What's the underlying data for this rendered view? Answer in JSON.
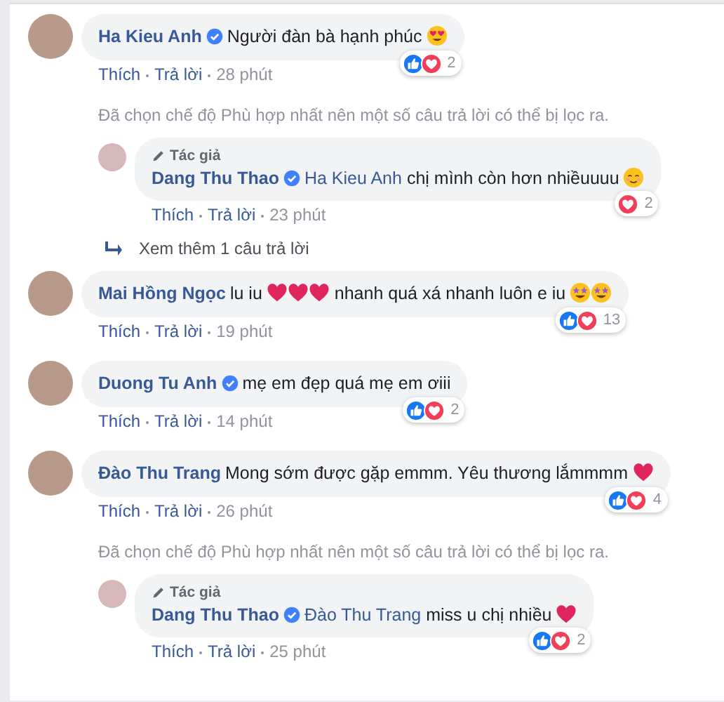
{
  "comments": [
    {
      "author": "Ha Kieu Anh",
      "verified": true,
      "body": [
        {
          "kind": "text",
          "text": "Người đàn bà hạnh phúc"
        },
        {
          "kind": "love-face"
        }
      ],
      "reactions": {
        "types": [
          {
            "kind": "like"
          },
          {
            "kind": "love"
          }
        ],
        "count": "2"
      },
      "actions": {
        "like": "Thích",
        "reply": "Trả lời",
        "time": "28 phút"
      },
      "children": [
        {
          "kind": "notice",
          "text": "Đã chọn chế độ Phù hợp nhất nên một số câu trả lời có thể bị lọc ra."
        },
        {
          "kind": "reply",
          "author_badge": "Tác giả",
          "author": "Dang Thu Thao",
          "verified": true,
          "body": [
            {
              "kind": "mention",
              "text": "Ha Kieu Anh"
            },
            {
              "kind": "text",
              "text": "chị mình còn hơn nhiềuuuu"
            },
            {
              "kind": "smile-face"
            }
          ],
          "reactions": {
            "types": [
              {
                "kind": "love"
              }
            ],
            "count": "2"
          },
          "actions": {
            "like": "Thích",
            "reply": "Trả lời",
            "time": "23 phút"
          }
        },
        {
          "kind": "more",
          "text": "Xem thêm 1 câu trả lời"
        }
      ]
    },
    {
      "author": "Mai Hồng Ngọc",
      "verified": false,
      "body": [
        {
          "kind": "text",
          "text": "lu iu"
        },
        {
          "kind": "heart"
        },
        {
          "kind": "heart"
        },
        {
          "kind": "heart"
        },
        {
          "kind": "text",
          "text": "nhanh quá xá nhanh luôn e iu"
        },
        {
          "kind": "star-face"
        },
        {
          "kind": "star-face"
        }
      ],
      "reactions": {
        "types": [
          {
            "kind": "like"
          },
          {
            "kind": "love"
          }
        ],
        "count": "13"
      },
      "actions": {
        "like": "Thích",
        "reply": "Trả lời",
        "time": "19 phút"
      }
    },
    {
      "author": "Duong Tu Anh",
      "verified": true,
      "body": [
        {
          "kind": "text",
          "text": "mẹ em đẹp quá mẹ em ơiii"
        }
      ],
      "reactions": {
        "types": [
          {
            "kind": "like"
          },
          {
            "kind": "love"
          }
        ],
        "count": "2"
      },
      "actions": {
        "like": "Thích",
        "reply": "Trả lời",
        "time": "14 phút"
      }
    },
    {
      "author": "Đào Thu Trang",
      "verified": false,
      "body": [
        {
          "kind": "text",
          "text": "Mong sớm được gặp emmm. Yêu thương lắmmmm"
        },
        {
          "kind": "heart"
        }
      ],
      "reactions": {
        "types": [
          {
            "kind": "like"
          },
          {
            "kind": "love"
          }
        ],
        "count": "4"
      },
      "actions": {
        "like": "Thích",
        "reply": "Trả lời",
        "time": "26 phút"
      },
      "children": [
        {
          "kind": "notice",
          "text": "Đã chọn chế độ Phù hợp nhất nên một số câu trả lời có thể bị lọc ra."
        },
        {
          "kind": "reply",
          "author_badge": "Tác giả",
          "author": "Dang Thu Thao",
          "verified": true,
          "body": [
            {
              "kind": "mention",
              "text": "Đào Thu Trang"
            },
            {
              "kind": "text",
              "text": "miss u chị nhiều"
            },
            {
              "kind": "heart"
            }
          ],
          "reactions": {
            "types": [
              {
                "kind": "like"
              },
              {
                "kind": "love"
              }
            ],
            "count": "2"
          },
          "actions": {
            "like": "Thích",
            "reply": "Trả lời",
            "time": "25 phút"
          }
        }
      ]
    }
  ]
}
